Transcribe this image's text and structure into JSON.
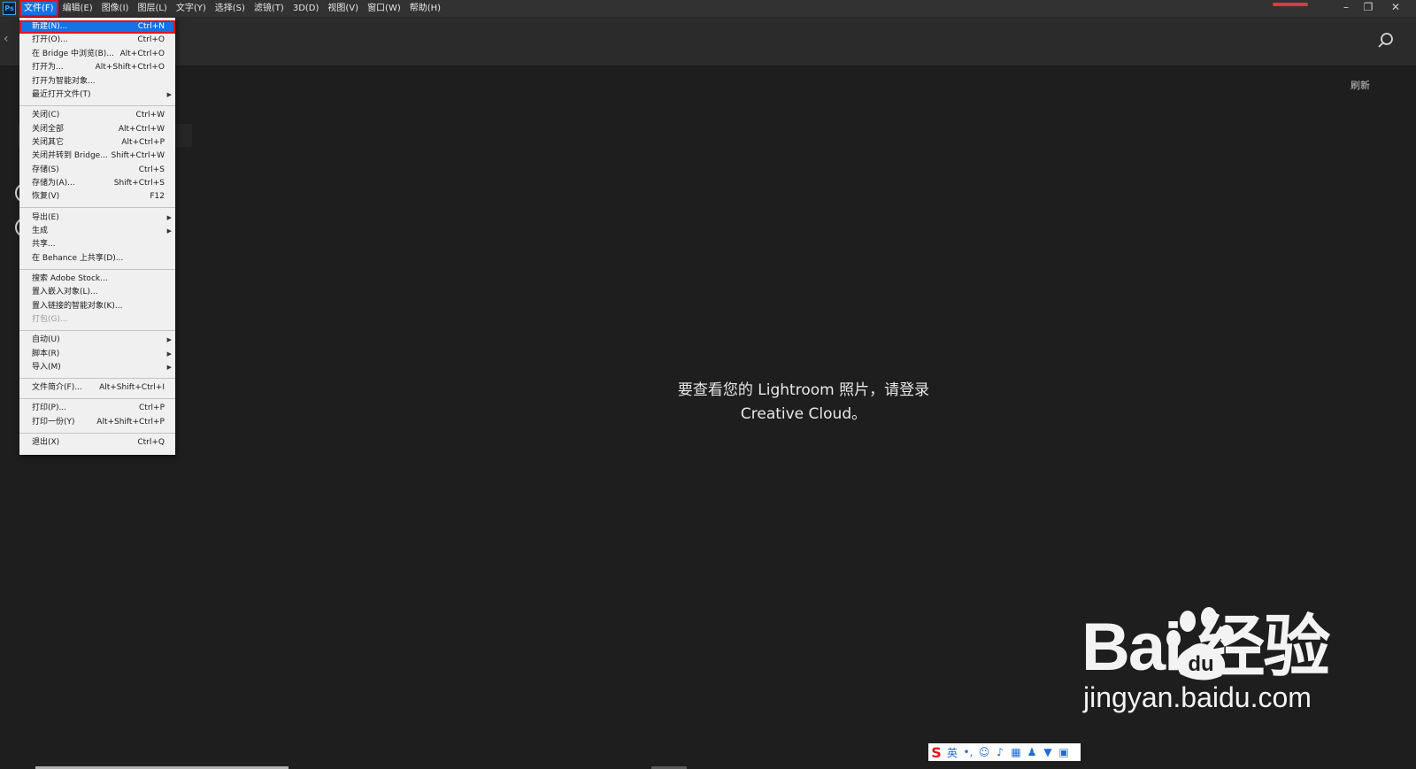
{
  "app": {
    "logo": "Ps"
  },
  "menubar": {
    "items": [
      "文件(F)",
      "编辑(E)",
      "图像(I)",
      "图层(L)",
      "文字(Y)",
      "选择(S)",
      "滤镜(T)",
      "3D(D)",
      "视图(V)",
      "窗口(W)",
      "帮助(H)"
    ],
    "active_index": 0
  },
  "window_controls": {
    "minimize": "–",
    "restore": "❐",
    "close": "✕"
  },
  "header": {
    "refresh_label": "刷新"
  },
  "file_menu": {
    "groups": [
      [
        {
          "label": "新建(N)...",
          "shortcut": "Ctrl+N",
          "highlight": true
        },
        {
          "label": "打开(O)...",
          "shortcut": "Ctrl+O"
        },
        {
          "label": "在 Bridge 中浏览(B)...",
          "shortcut": "Alt+Ctrl+O"
        },
        {
          "label": "打开为...",
          "shortcut": "Alt+Shift+Ctrl+O"
        },
        {
          "label": "打开为智能对象...",
          "shortcut": ""
        },
        {
          "label": "最近打开文件(T)",
          "shortcut": "",
          "submenu": true
        }
      ],
      [
        {
          "label": "关闭(C)",
          "shortcut": "Ctrl+W"
        },
        {
          "label": "关闭全部",
          "shortcut": "Alt+Ctrl+W"
        },
        {
          "label": "关闭其它",
          "shortcut": "Alt+Ctrl+P"
        },
        {
          "label": "关闭并转到 Bridge...",
          "shortcut": "Shift+Ctrl+W"
        },
        {
          "label": "存储(S)",
          "shortcut": "Ctrl+S"
        },
        {
          "label": "存储为(A)...",
          "shortcut": "Shift+Ctrl+S"
        },
        {
          "label": "恢复(V)",
          "shortcut": "F12"
        }
      ],
      [
        {
          "label": "导出(E)",
          "shortcut": "",
          "submenu": true
        },
        {
          "label": "生成",
          "shortcut": "",
          "submenu": true
        },
        {
          "label": "共享...",
          "shortcut": ""
        },
        {
          "label": "在 Behance 上共享(D)...",
          "shortcut": ""
        }
      ],
      [
        {
          "label": "搜索 Adobe Stock...",
          "shortcut": ""
        },
        {
          "label": "置入嵌入对象(L)...",
          "shortcut": ""
        },
        {
          "label": "置入链接的智能对象(K)...",
          "shortcut": ""
        },
        {
          "label": "打包(G)...",
          "shortcut": "",
          "disabled": true
        }
      ],
      [
        {
          "label": "自动(U)",
          "shortcut": "",
          "submenu": true
        },
        {
          "label": "脚本(R)",
          "shortcut": "",
          "submenu": true
        },
        {
          "label": "导入(M)",
          "shortcut": "",
          "submenu": true
        }
      ],
      [
        {
          "label": "文件简介(F)...",
          "shortcut": "Alt+Shift+Ctrl+I"
        }
      ],
      [
        {
          "label": "打印(P)...",
          "shortcut": "Ctrl+P"
        },
        {
          "label": "打印一份(Y)",
          "shortcut": "Alt+Shift+Ctrl+P"
        }
      ],
      [
        {
          "label": "退出(X)",
          "shortcut": "Ctrl+Q"
        }
      ]
    ]
  },
  "main": {
    "message_line1": "要查看您的 Lightroom 照片，请登录",
    "message_line2": "Creative Cloud。"
  },
  "watermark": {
    "brand": "Bai   经验",
    "url": "jingyan.baidu.com",
    "paw_text": "du"
  },
  "ime": {
    "logo": "S",
    "lang": "英"
  },
  "colors": {
    "highlight": "#1473e6",
    "annotation_red": "#e3131c",
    "background": "#1e1e1e",
    "menu_bg": "#f0f0f0"
  }
}
